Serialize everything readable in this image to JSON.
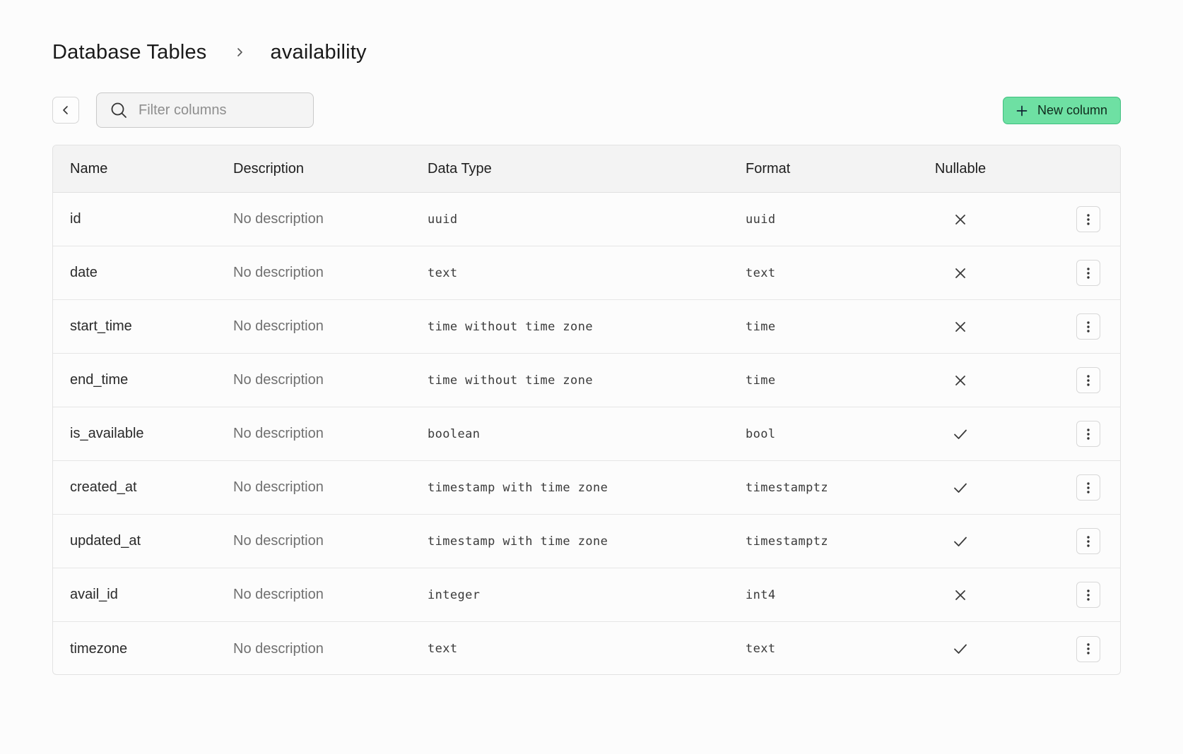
{
  "breadcrumb": {
    "root": "Database Tables",
    "separator_icon": "chevron-right-icon",
    "current": "availability"
  },
  "toolbar": {
    "back_icon": "chevron-left-icon",
    "search_icon": "search-icon",
    "search_placeholder": "Filter columns",
    "search_value": "",
    "new_column_label": "New column",
    "new_column_icon": "plus-icon"
  },
  "colors": {
    "accent": "#6ee0a3",
    "accent_border": "#3fbf7f"
  },
  "table": {
    "headers": {
      "name": "Name",
      "description": "Description",
      "data_type": "Data Type",
      "format": "Format",
      "nullable": "Nullable"
    },
    "rows": [
      {
        "name": "id",
        "description": "No description",
        "data_type": "uuid",
        "format": "uuid",
        "nullable": false
      },
      {
        "name": "date",
        "description": "No description",
        "data_type": "text",
        "format": "text",
        "nullable": false
      },
      {
        "name": "start_time",
        "description": "No description",
        "data_type": "time without time zone",
        "format": "time",
        "nullable": false
      },
      {
        "name": "end_time",
        "description": "No description",
        "data_type": "time without time zone",
        "format": "time",
        "nullable": false
      },
      {
        "name": "is_available",
        "description": "No description",
        "data_type": "boolean",
        "format": "bool",
        "nullable": true
      },
      {
        "name": "created_at",
        "description": "No description",
        "data_type": "timestamp with time zone",
        "format": "timestamptz",
        "nullable": true
      },
      {
        "name": "updated_at",
        "description": "No description",
        "data_type": "timestamp with time zone",
        "format": "timestamptz",
        "nullable": true
      },
      {
        "name": "avail_id",
        "description": "No description",
        "data_type": "integer",
        "format": "int4",
        "nullable": false
      },
      {
        "name": "timezone",
        "description": "No description",
        "data_type": "text",
        "format": "text",
        "nullable": true
      }
    ]
  }
}
